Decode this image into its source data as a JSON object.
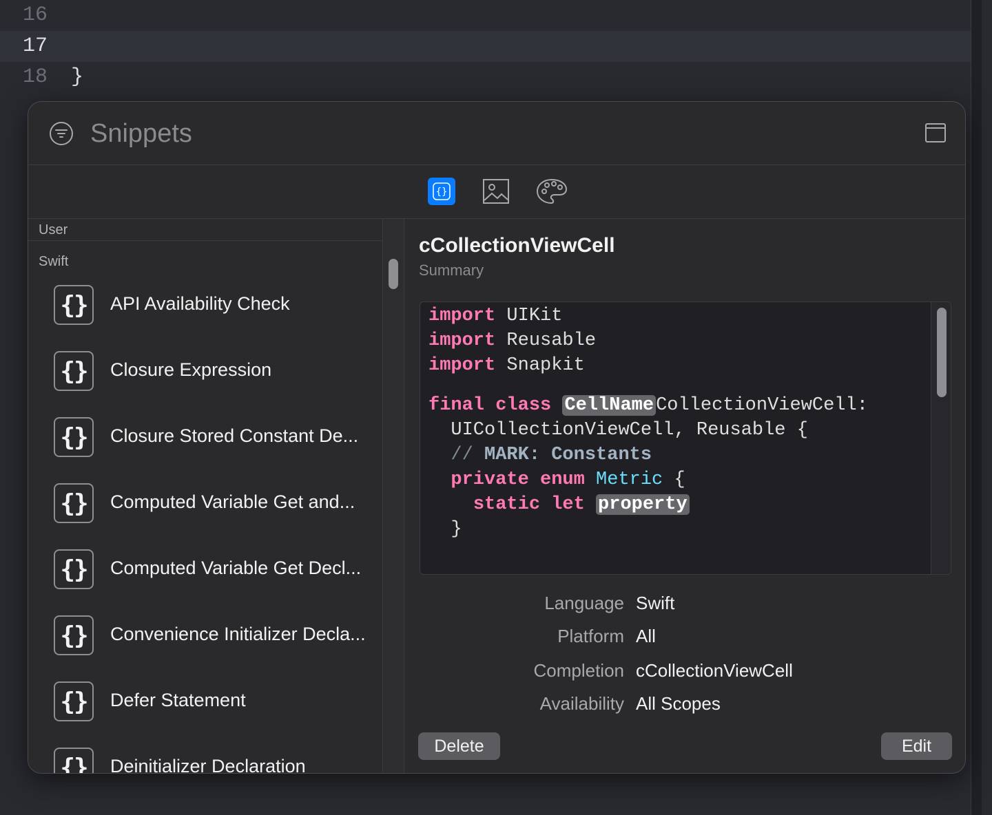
{
  "editor": {
    "lines": [
      {
        "num": "16",
        "code": ""
      },
      {
        "num": "17",
        "code": ""
      },
      {
        "num": "18",
        "code": "}"
      }
    ]
  },
  "popover": {
    "search_placeholder": "Snippets",
    "tabs": [
      {
        "name": "code-snippets",
        "icon": "braces-icon",
        "active": true
      },
      {
        "name": "media",
        "icon": "image-icon",
        "active": false
      },
      {
        "name": "colors",
        "icon": "palette-icon",
        "active": false
      }
    ],
    "sections": {
      "user": "User",
      "swift": "Swift"
    },
    "items": [
      {
        "icon": "{}",
        "label": "API Availability Check"
      },
      {
        "icon": "{}",
        "label": "Closure Expression"
      },
      {
        "icon": "{}",
        "label": "Closure Stored Constant De..."
      },
      {
        "icon": "{}",
        "label": "Computed Variable Get and..."
      },
      {
        "icon": "{}",
        "label": "Computed Variable Get Decl..."
      },
      {
        "icon": "{}",
        "label": "Convenience Initializer Decla..."
      },
      {
        "icon": "{}",
        "label": "Defer Statement"
      },
      {
        "icon": "{}",
        "label": "Deinitializer Declaration"
      }
    ],
    "detail": {
      "title": "cCollectionViewCell",
      "summary": "Summary",
      "code": {
        "kw_import": "import",
        "mod1": "UIKit",
        "mod2": "Reusable",
        "mod3": "Snapkit",
        "kw_final": "final",
        "kw_class": "class",
        "ph_cellname": "CellName",
        "class_rest": "CollectionViewCell:",
        "conformance": "UICollectionViewCell, Reusable {",
        "comment_slashes": "//",
        "comment_mark": "MARK: Constants",
        "kw_private": "private",
        "kw_enum": "enum",
        "type_metric": "Metric",
        "open_brace": "{",
        "kw_static": "static",
        "kw_let": "let",
        "ph_property": "property",
        "close_brace": "}"
      },
      "meta": [
        {
          "label": "Language",
          "value": "Swift"
        },
        {
          "label": "Platform",
          "value": "All"
        },
        {
          "label": "Completion",
          "value": "cCollectionViewCell"
        },
        {
          "label": "Availability",
          "value": "All Scopes"
        }
      ],
      "delete_label": "Delete",
      "edit_label": "Edit"
    }
  },
  "colors": {
    "accent": "#0a7cff",
    "keyword": "#ff7ab2",
    "type": "#6bdfff",
    "background": "#292a30"
  }
}
